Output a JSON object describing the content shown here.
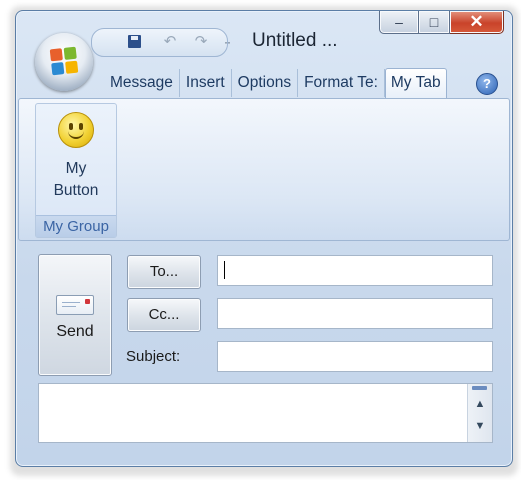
{
  "window": {
    "title": "Untitled ...",
    "more_glyph": "··",
    "minimize_glyph": "–",
    "maximize_glyph": "□",
    "close_glyph": "✕"
  },
  "quick_access": {
    "items": [
      {
        "name": "save-icon"
      },
      {
        "name": "undo-icon",
        "glyph": "↶"
      },
      {
        "name": "redo-icon",
        "glyph": "↷"
      }
    ]
  },
  "tabs": [
    {
      "label": "Message"
    },
    {
      "label": "Insert"
    },
    {
      "label": "Options"
    },
    {
      "label": "Format Te:"
    },
    {
      "label": "My Tab",
      "active": true
    }
  ],
  "help_glyph": "?",
  "ribbon": {
    "group_label": "My Group",
    "button_line1": "My",
    "button_line2": "Button"
  },
  "compose": {
    "send_label": "Send",
    "to_label": "To...",
    "cc_label": "Cc...",
    "subject_label": "Subject:",
    "to_value": "",
    "cc_value": "",
    "subject_value": "",
    "body_value": "",
    "scroll_up_glyph": "▲",
    "scroll_down_glyph": "▼"
  },
  "colors": {
    "accent": "#2c62b4",
    "close_button": "#c9432a",
    "group_label_text": "#3a64a4"
  }
}
